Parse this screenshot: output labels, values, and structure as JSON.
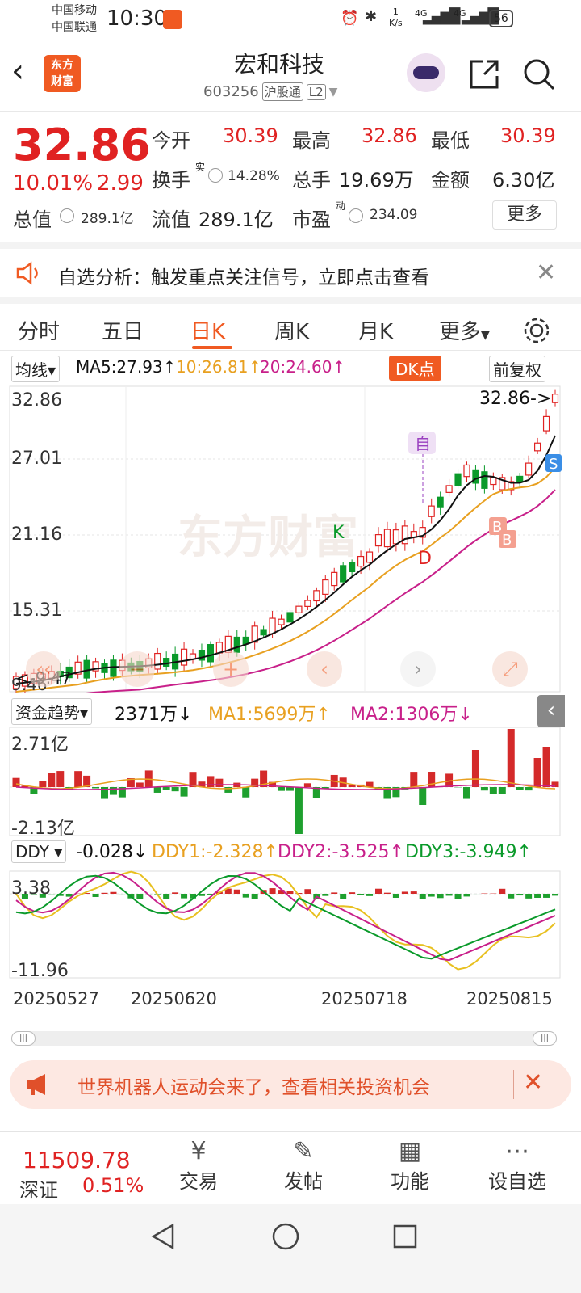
{
  "status_bar": {
    "carrier1": "中国移动",
    "carrier2": "中国联通",
    "time": "10:30",
    "speed": "1\nK/s",
    "signal1": "4G",
    "signal2": "4G",
    "battery": "56"
  },
  "header": {
    "back_icon": "chevron-left-icon",
    "logo_line1": "东方",
    "logo_line2": "财富",
    "title": "宏和科技",
    "code": "603256",
    "tag1": "沪股通",
    "tag2": "L2"
  },
  "quote": {
    "price": "32.86",
    "change_pct": "10.01%",
    "change_abs": "2.99",
    "open_label": "今开",
    "open": "30.39",
    "high_label": "最高",
    "high": "32.86",
    "low_label": "最低",
    "low": "30.39",
    "turnover_label": "换手",
    "turnover_sup": "实",
    "turnover": "14.28%",
    "volume_label": "总手",
    "volume": "19.69万",
    "amount_label": "金额",
    "amount": "6.30亿",
    "mktcap_label": "总值",
    "mktcap": "289.1亿",
    "float_label": "流值",
    "float": "289.1亿",
    "pe_label": "市盈",
    "pe_sup": "动",
    "pe": "234.09",
    "more_label": "更多"
  },
  "notice": {
    "text": "自选分析：触发重点关注信号，立即点击查看"
  },
  "tabs": [
    {
      "label": "分时"
    },
    {
      "label": "五日"
    },
    {
      "label": "日K"
    },
    {
      "label": "周K"
    },
    {
      "label": "月K"
    },
    {
      "label": "更多"
    }
  ],
  "kline": {
    "selector": "均线",
    "ma5": "MA5:27.93↑",
    "ma10": "10:26.81↑",
    "ma20": "20:24.60↑",
    "dk_label": "DK点",
    "adjust_label": "前复权",
    "y_ticks": [
      "32.86",
      "27.01",
      "21.16",
      "15.31"
    ],
    "price_marker": "32.86->",
    "low_marker": "<-9.47",
    "low_tick": "9.46",
    "marker_self": "自",
    "marker_k": "K",
    "marker_d": "D",
    "marker_b": "B",
    "marker_s": "S",
    "watermark": "东方财富",
    "colors": {
      "ma5": "#111111",
      "ma10": "#e8a020",
      "ma20": "#c8208a",
      "up": "#e02222",
      "down": "#0a9a2a"
    }
  },
  "fund": {
    "selector": "资金趋势",
    "value": "2371万↓",
    "ma1": "MA1:5699万↑",
    "ma2": "MA2:1306万↓",
    "y_top": "2.71亿",
    "y_bottom": "-2.13亿"
  },
  "ddy": {
    "selector": "DDY",
    "value": "-0.028↓",
    "ddy1": "DDY1:-2.328↑",
    "ddy2": "DDY2:-3.525↑",
    "ddy3": "DDY3:-3.949↑",
    "y_top": "3.38",
    "y_bottom": "-11.96"
  },
  "dates": [
    "20250527",
    "20250620",
    "20250718",
    "20250815"
  ],
  "promo": {
    "text": "世界机器人运动会来了，查看相关投资机会"
  },
  "bottom": {
    "index_value": "11509.78",
    "index_name": "深证",
    "index_pct": "0.51%",
    "items": [
      {
        "label": "交易",
        "icon": "trade-icon"
      },
      {
        "label": "发帖",
        "icon": "post-icon"
      },
      {
        "label": "功能",
        "icon": "apps-icon"
      },
      {
        "label": "设自选",
        "icon": "more-dots-icon"
      }
    ]
  }
}
